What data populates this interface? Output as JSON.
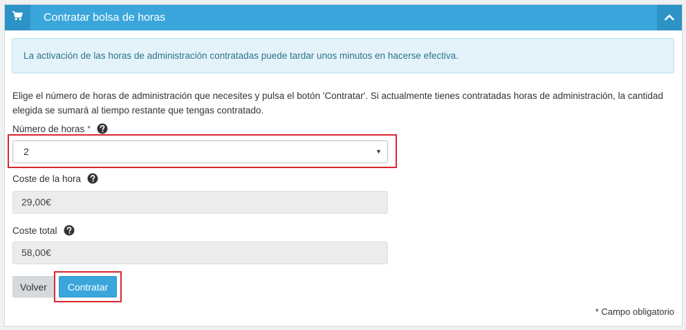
{
  "header": {
    "title": "Contratar bolsa de horas",
    "cart_icon": "cart-icon",
    "collapse_icon": "chevron-up-icon"
  },
  "alert": {
    "text": "La activación de las horas de administración contratadas puede tardar unos minutos en hacerse efectiva."
  },
  "description": "Elige el número de horas de administración que necesites y pulsa el botón 'Contratar'. Si actualmente tienes contratadas horas de administración, la cantidad elegida se sumará al tiempo restante que tengas contratado.",
  "form": {
    "hours": {
      "label": "Número de horas",
      "required_mark": "*",
      "selected_value": "2",
      "help_icon": "question-circle-icon"
    },
    "hour_cost": {
      "label": "Coste de la hora",
      "value": "29,00€",
      "help_icon": "question-circle-icon"
    },
    "total_cost": {
      "label": "Coste total",
      "value": "58,00€",
      "help_icon": "question-circle-icon"
    }
  },
  "buttons": {
    "back_label": "Volver",
    "submit_label": "Contratar"
  },
  "footnote": "* Campo obligatorio",
  "colors": {
    "header_bg": "#3aa6dc",
    "header_icon_bg": "#2d93c7",
    "alert_bg": "#e4f3fa",
    "alert_text": "#31708f",
    "highlight": "#d62730",
    "submit_bg": "#3aa6dc"
  }
}
